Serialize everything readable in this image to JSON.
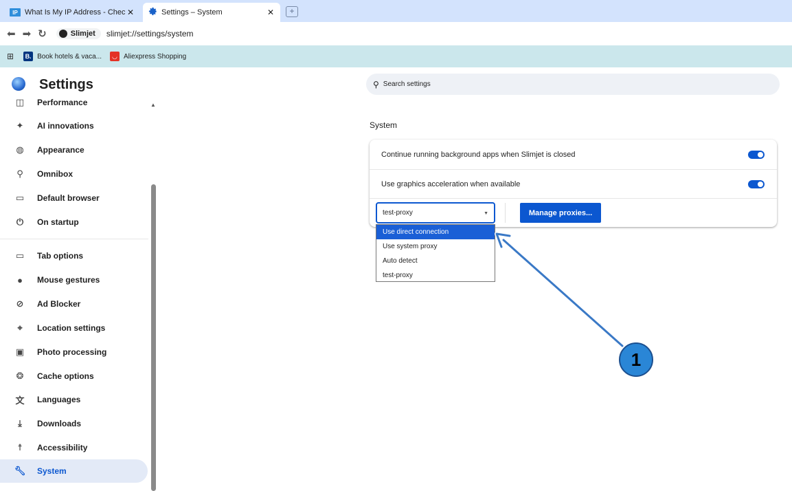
{
  "tabs": [
    {
      "title": "What Is My IP Address - Check",
      "favicon": "IP",
      "active": false
    },
    {
      "title": "Settings – System",
      "favicon": "gear-icon",
      "active": true
    }
  ],
  "toolbar": {
    "site_chip": "Slimjet",
    "url": "slimjet://settings/system"
  },
  "bookmarks": [
    {
      "label": "Book hotels & vaca...",
      "icon_text": "B.",
      "color": "#003580"
    },
    {
      "label": "Aliexpress Shopping",
      "icon_text": "",
      "color": "#e43225"
    }
  ],
  "header": {
    "title": "Settings",
    "search_placeholder": "Search settings"
  },
  "sidebar": {
    "items": [
      {
        "label": "Performance",
        "icon": "performance-icon"
      },
      {
        "label": "AI innovations",
        "icon": "sparkle-icon"
      },
      {
        "label": "Appearance",
        "icon": "palette-icon"
      },
      {
        "label": "Omnibox",
        "icon": "search-icon"
      },
      {
        "label": "Default browser",
        "icon": "browser-window-icon"
      },
      {
        "label": "On startup",
        "icon": "power-icon"
      },
      {
        "label": "Tab options",
        "icon": "tab-icon"
      },
      {
        "label": "Mouse gestures",
        "icon": "mouse-icon"
      },
      {
        "label": "Ad Blocker",
        "icon": "ad-blocker-icon"
      },
      {
        "label": "Location settings",
        "icon": "location-pin-icon"
      },
      {
        "label": "Photo processing",
        "icon": "photo-icon"
      },
      {
        "label": "Cache options",
        "icon": "cookie-icon"
      },
      {
        "label": "Languages",
        "icon": "translate-icon"
      },
      {
        "label": "Downloads",
        "icon": "download-icon"
      },
      {
        "label": "Accessibility",
        "icon": "accessibility-icon"
      },
      {
        "label": "System",
        "icon": "wrench-icon",
        "active": true
      }
    ]
  },
  "system": {
    "section_title": "System",
    "background_apps_label": "Continue running background apps when Slimjet is closed",
    "background_apps_on": true,
    "graphics_accel_label": "Use graphics acceleration when available",
    "graphics_accel_on": true,
    "proxy_selected": "test-proxy",
    "manage_proxies_label": "Manage proxies...",
    "proxy_options": [
      "Use direct connection",
      "Use system proxy",
      "Auto detect",
      "test-proxy"
    ],
    "highlighted_option": "Use direct connection"
  },
  "annotation": {
    "badge_number": "1",
    "accent": "#2a86d6"
  },
  "colors": {
    "tabstrip": "#d3e3fd",
    "bookmarks_bar": "#cbe7ec",
    "accent_blue": "#0b57d0"
  }
}
